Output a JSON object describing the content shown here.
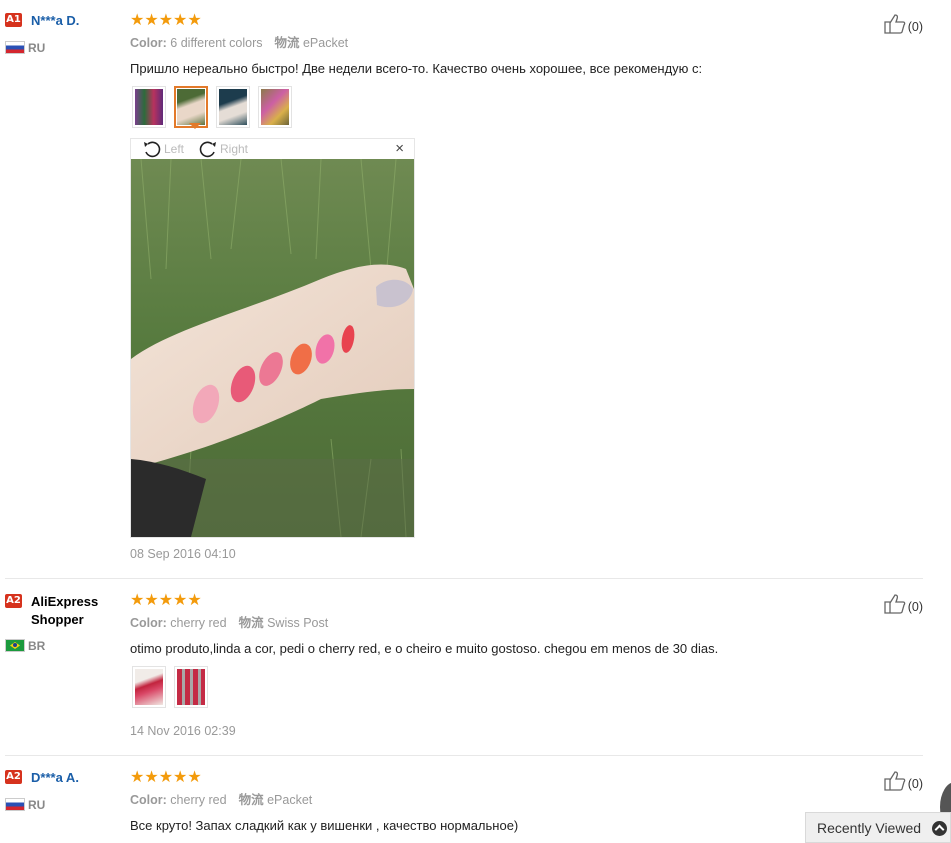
{
  "reviews": [
    {
      "level": "A1",
      "name": "N***a D.",
      "country": "RU",
      "stars": "★★★★★",
      "color_label": "Color:",
      "color_value": "6 different colors",
      "shipping_label": "物流",
      "shipping_value": "ePacket",
      "text": "Пришло нереально быстро! Две недели всего-то. Качество очень хорошее, все рекомендую с:",
      "helpful": "(0)",
      "date": "08 Sep 2016 04:10",
      "viewer": {
        "left_label": "Left",
        "right_label": "Right",
        "close": "×"
      }
    },
    {
      "level": "A2",
      "name": "AliExpress Shopper",
      "country": "BR",
      "stars": "★★★★★",
      "color_label": "Color:",
      "color_value": "cherry red",
      "shipping_label": "物流",
      "shipping_value": "Swiss Post",
      "text": "otimo produto,linda a cor, pedi o cherry red, e o cheiro e muito gostoso. chegou em menos de 30 dias.",
      "helpful": "(0)",
      "date": "14 Nov 2016 02:39"
    },
    {
      "level": "A2",
      "name": "D***a A.",
      "country": "RU",
      "stars": "★★★★★",
      "color_label": "Color:",
      "color_value": "cherry red",
      "shipping_label": "物流",
      "shipping_value": "ePacket",
      "text": "Все круто! Запах сладкий как у вишенки , качество нормальное)",
      "helpful": "(0)"
    }
  ],
  "recently_viewed": "Recently Viewed",
  "colors": {
    "star": "#f39b0c",
    "level_badge": "#d6321d",
    "link": "#1a5ea8",
    "active_thumb": "#e37a2a"
  }
}
